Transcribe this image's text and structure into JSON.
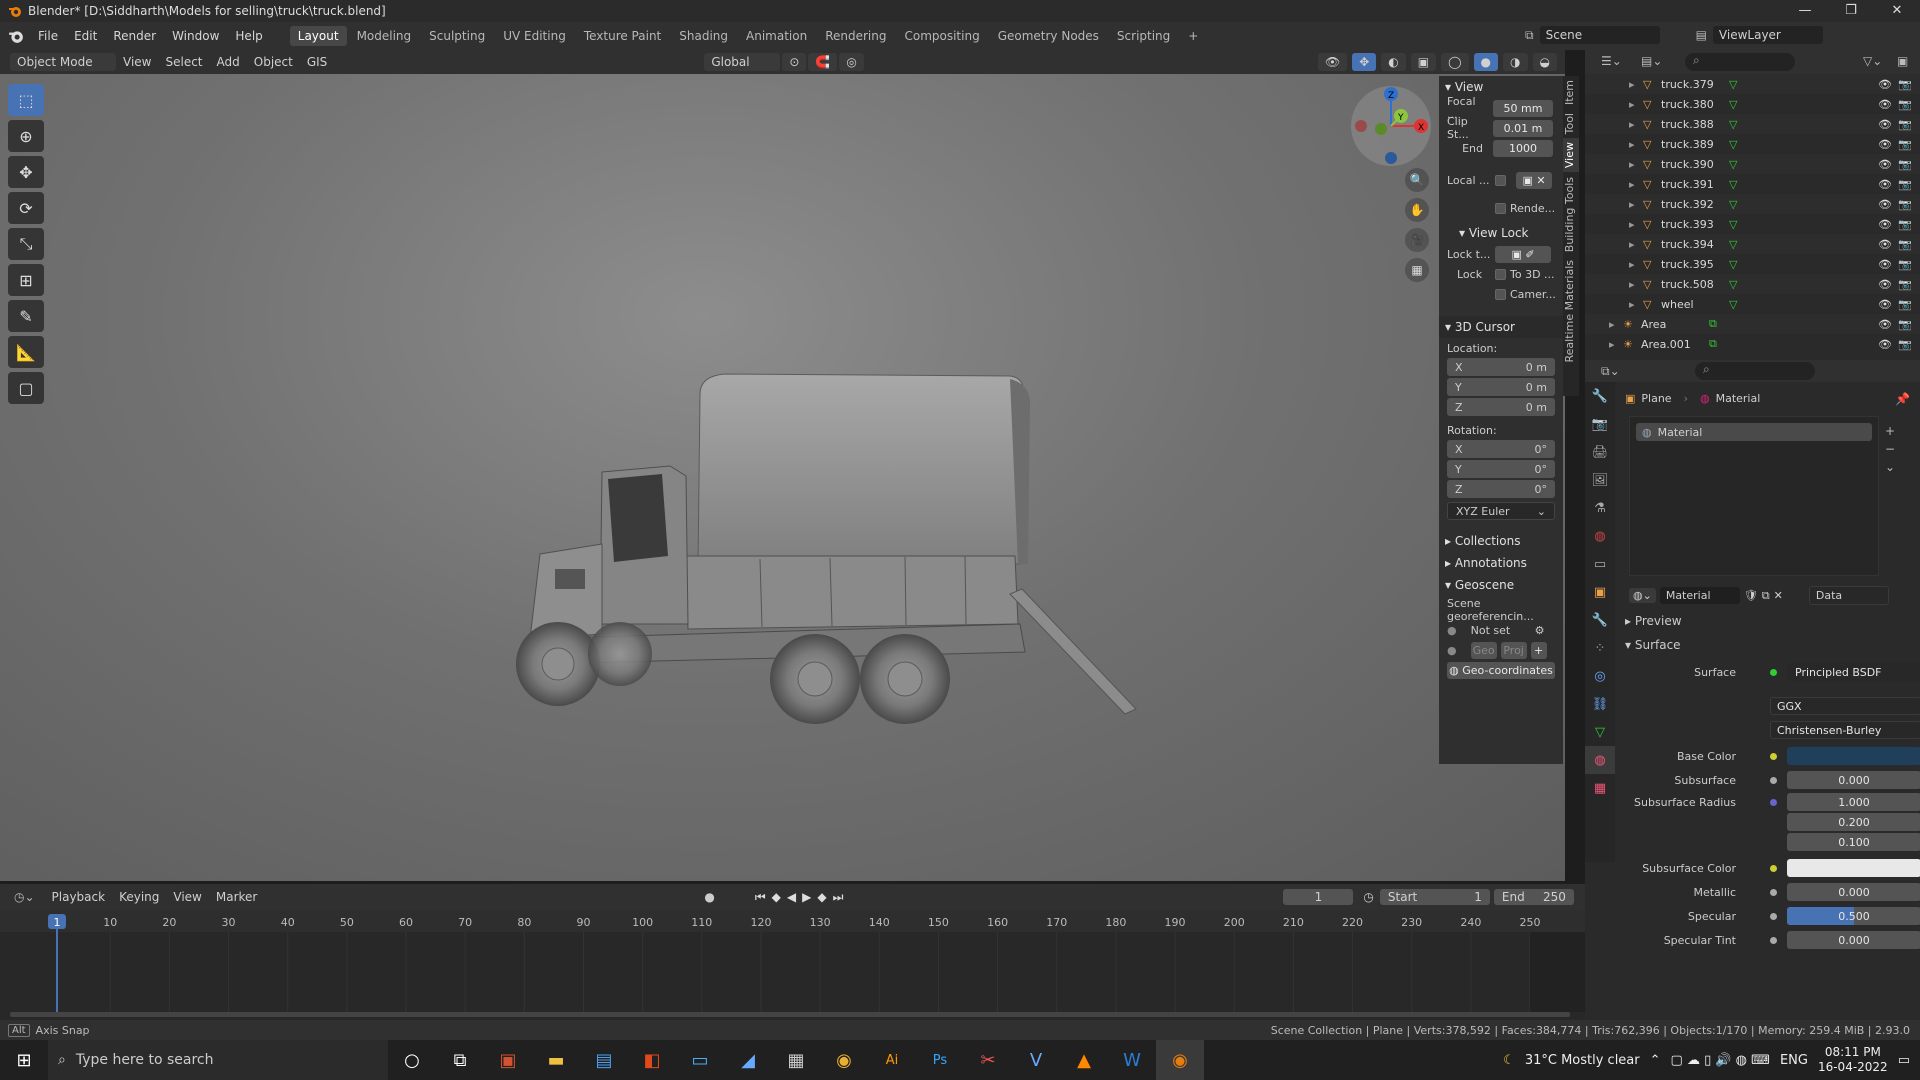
{
  "window": {
    "title": "Blender* [D:\\Siddharth\\Models for selling\\truck\\truck.blend]",
    "min": "—",
    "max": "❐",
    "close": "✕"
  },
  "menu": [
    "File",
    "Edit",
    "Render",
    "Window",
    "Help"
  ],
  "workspaces": [
    "Layout",
    "Modeling",
    "Sculpting",
    "UV Editing",
    "Texture Paint",
    "Shading",
    "Animation",
    "Rendering",
    "Compositing",
    "Geometry Nodes",
    "Scripting"
  ],
  "active_workspace": "Layout",
  "scene": {
    "label": "Scene",
    "viewlayer": "ViewLayer"
  },
  "viewport_header": {
    "mode": "Object Mode",
    "view": "View",
    "select": "Select",
    "add": "Add",
    "object": "Object",
    "gis": "GIS",
    "transform": "Global"
  },
  "npanel": {
    "view_title": "View",
    "focal_label": "Focal ...",
    "focal_value": "50 mm",
    "clip_start_label": "Clip St...",
    "clip_start_value": "0.01 m",
    "clip_end_label": "End",
    "clip_end_value": "1000",
    "local_label": "Local ...",
    "render_label": "Rende...",
    "view_lock_title": "View Lock",
    "lock_to_label": "Lock t...",
    "lock_label": "Lock",
    "to3d_label": "To 3D ...",
    "camera_label": "Camer...",
    "cursor_title": "3D Cursor",
    "location_label": "Location:",
    "loc": [
      {
        "axis": "X",
        "value": "0 m"
      },
      {
        "axis": "Y",
        "value": "0 m"
      },
      {
        "axis": "Z",
        "value": "0 m"
      }
    ],
    "rotation_label": "Rotation:",
    "rot": [
      {
        "axis": "X",
        "value": "0°"
      },
      {
        "axis": "Y",
        "value": "0°"
      },
      {
        "axis": "Z",
        "value": "0°"
      }
    ],
    "euler": "XYZ Euler",
    "collections": "Collections",
    "annotations": "Annotations",
    "geoscene": "Geoscene",
    "scene_geo": "Scene georeferencin...",
    "not_set": "Not set",
    "geo_btn": "Geo",
    "proj_btn": "Proj",
    "geo_coords": "Geo-coordinates"
  },
  "side_tabs": [
    "Item",
    "Tool",
    "View",
    "Building Tools",
    "Realtime Materials"
  ],
  "outliner": {
    "rows": [
      "truck.379",
      "truck.380",
      "truck.388",
      "truck.389",
      "truck.390",
      "truck.391",
      "truck.392",
      "truck.393",
      "truck.394",
      "truck.395",
      "truck.508",
      "wheel",
      "Area",
      "Area.001"
    ]
  },
  "properties": {
    "object": "Plane",
    "material_tab": "Material",
    "slot": "Material",
    "mat_name": "Material",
    "data_link": "Data",
    "preview": "Preview",
    "surface_section": "Surface",
    "surface_label": "Surface",
    "surface_value": "Principled BSDF",
    "distribution": "GGX",
    "subsurface_method": "Christensen-Burley",
    "base_color_label": "Base Color",
    "base_color": "#1f3f5a",
    "subsurface_label": "Subsurface",
    "subsurface_value": "0.000",
    "ss_radius_label": "Subsurface Radius",
    "ss_radius": [
      "1.000",
      "0.200",
      "0.100"
    ],
    "ss_color_label": "Subsurface Color",
    "ss_color": "#e8e8e8",
    "metallic_label": "Metallic",
    "metallic_value": "0.000",
    "specular_label": "Specular",
    "specular_value": "0.500",
    "specular_fraction": 0.5,
    "spec_tint_label": "Specular Tint",
    "spec_tint_value": "0.000"
  },
  "timeline": {
    "playback": "Playback",
    "keying": "Keying",
    "view": "View",
    "marker": "Marker",
    "current": "1",
    "start_label": "Start",
    "start": "1",
    "end_label": "End",
    "end": "250",
    "ticks": [
      "1",
      "10",
      "20",
      "30",
      "40",
      "50",
      "60",
      "70",
      "80",
      "90",
      "100",
      "110",
      "120",
      "130",
      "140",
      "150",
      "160",
      "170",
      "180",
      "190",
      "200",
      "210",
      "220",
      "230",
      "240",
      "250"
    ]
  },
  "status": {
    "left_key": "Alt",
    "left_text": "Axis Snap",
    "right_text": "Scene Collection | Plane | Verts:378,592 | Faces:384,774 | Tris:762,396 | Objects:1/170 | Memory: 259.4 MiB | 2.93.0"
  },
  "taskbar": {
    "search_placeholder": "Type here to search",
    "weather": "31°C  Mostly clear",
    "lang": "ENG",
    "time": "08:11 PM",
    "date": "16-04-2022"
  }
}
